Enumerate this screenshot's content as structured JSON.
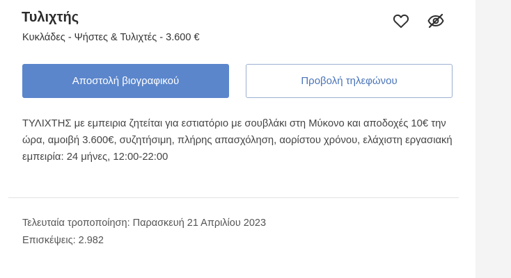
{
  "listing": {
    "title": "Τυλιχτής",
    "subtitle": "Κυκλάδες - Ψήστες & Τυλιχτές - 3.600 €",
    "favorite_icon": "heart-icon",
    "hide_icon": "eye-slash-icon",
    "apply_button": "Αποστολή βιογραφικού",
    "phone_button": "Προβολή τηλεφώνου",
    "description": "ΤΥΛΙΧΤΗΣ με εμπειρια ζητείται για εστιατόριο με σουβλάκι στη Μύκονο και αποδοχές 10€ την ώρα, αμοιβή 3.600€, συζητήσιμη, πλήρης απασχόληση, αορίστου χρόνου, ελάχιστη εργασιακή εμπειρία: 24 μήνες, 12:00-22:00",
    "last_modified": "Τελευταία τροποποίηση: Παρασκευή 21 Απριλίου 2023",
    "views": "Επισκέψεις: 2.982"
  },
  "colors": {
    "primary": "#5b86cc",
    "secondary_text": "#4a74b8",
    "background": "#f4f4f4",
    "card": "#ffffff"
  }
}
